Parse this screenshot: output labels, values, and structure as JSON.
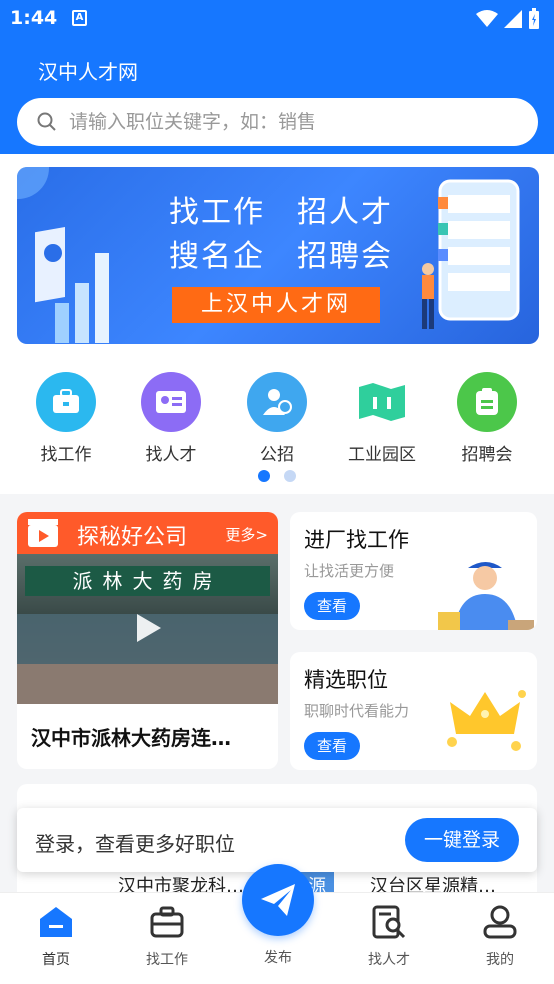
{
  "status": {
    "time": "1:44",
    "notification_badge": "A"
  },
  "header": {
    "title": "汉中人才网",
    "search_placeholder": "请输入职位关键字，如：销售"
  },
  "banner": {
    "line1_left": "找工作",
    "line1_right": "招人才",
    "line2_left": "搜名企",
    "line2_right": "招聘会",
    "button": "上汉中人才网"
  },
  "categories": [
    {
      "label": "找工作",
      "icon": "briefcase-icon",
      "color": "#2bb8ef"
    },
    {
      "label": "找人才",
      "icon": "id-card-icon",
      "color": "#8c6cf5"
    },
    {
      "label": "公招",
      "icon": "person-medal-icon",
      "color": "#3fa7ef"
    },
    {
      "label": "工业园区",
      "icon": "map-icon",
      "color": "#2fcf9c"
    },
    {
      "label": "招聘会",
      "icon": "clipboard-icon",
      "color": "#4cc74a"
    }
  ],
  "pager": {
    "active": 1,
    "total": 2
  },
  "video_card": {
    "title": "探秘好公司",
    "more": "更多>",
    "sign_text": "派林大药房",
    "caption": "汉中市派林大药房连…"
  },
  "promo_cards": [
    {
      "title": "进厂找工作",
      "subtitle": "让找活更方便",
      "button": "查看"
    },
    {
      "title": "精选职位",
      "subtitle": "职聊时代看能力",
      "button": "查看"
    }
  ],
  "company_row": {
    "left": "汉中市聚龙科…",
    "tag": "星源",
    "right": "汉台区星源精…"
  },
  "login_bar": {
    "text": "登录，查看更多好职位",
    "button": "一键登录"
  },
  "nav": {
    "items": [
      {
        "label": "首页",
        "icon": "home-icon"
      },
      {
        "label": "找工作",
        "icon": "briefcase-icon"
      },
      {
        "label": "发布",
        "icon": "paper-plane-icon"
      },
      {
        "label": "找人才",
        "icon": "document-search-icon"
      },
      {
        "label": "我的",
        "icon": "user-icon"
      }
    ],
    "active_color": "#1677ff"
  },
  "colors": {
    "primary": "#1677ff",
    "accent": "#ff6a14",
    "video_head": "#ff5a2a"
  }
}
